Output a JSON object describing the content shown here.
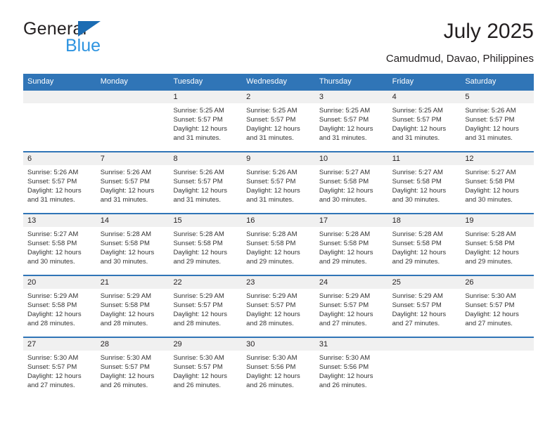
{
  "brand": {
    "name_top": "General",
    "name_bottom": "Blue",
    "logo_icon": "blue-triangle-icon",
    "accent_color": "#1b6cb3",
    "secondary_color": "#2e94e0"
  },
  "header": {
    "title": "July 2025",
    "subtitle": "Camudmud, Davao, Philippines"
  },
  "calendar": {
    "header_bg_color": "#3075b7",
    "day_band_color": "#f0f0f0",
    "weekdays": [
      "Sunday",
      "Monday",
      "Tuesday",
      "Wednesday",
      "Thursday",
      "Friday",
      "Saturday"
    ],
    "weeks": [
      [
        {
          "date": "",
          "sunrise": "",
          "sunset": "",
          "daylight_line1": "",
          "daylight_line2": ""
        },
        {
          "date": "",
          "sunrise": "",
          "sunset": "",
          "daylight_line1": "",
          "daylight_line2": ""
        },
        {
          "date": "1",
          "sunrise": "Sunrise: 5:25 AM",
          "sunset": "Sunset: 5:57 PM",
          "daylight_line1": "Daylight: 12 hours",
          "daylight_line2": "and 31 minutes."
        },
        {
          "date": "2",
          "sunrise": "Sunrise: 5:25 AM",
          "sunset": "Sunset: 5:57 PM",
          "daylight_line1": "Daylight: 12 hours",
          "daylight_line2": "and 31 minutes."
        },
        {
          "date": "3",
          "sunrise": "Sunrise: 5:25 AM",
          "sunset": "Sunset: 5:57 PM",
          "daylight_line1": "Daylight: 12 hours",
          "daylight_line2": "and 31 minutes."
        },
        {
          "date": "4",
          "sunrise": "Sunrise: 5:25 AM",
          "sunset": "Sunset: 5:57 PM",
          "daylight_line1": "Daylight: 12 hours",
          "daylight_line2": "and 31 minutes."
        },
        {
          "date": "5",
          "sunrise": "Sunrise: 5:26 AM",
          "sunset": "Sunset: 5:57 PM",
          "daylight_line1": "Daylight: 12 hours",
          "daylight_line2": "and 31 minutes."
        }
      ],
      [
        {
          "date": "6",
          "sunrise": "Sunrise: 5:26 AM",
          "sunset": "Sunset: 5:57 PM",
          "daylight_line1": "Daylight: 12 hours",
          "daylight_line2": "and 31 minutes."
        },
        {
          "date": "7",
          "sunrise": "Sunrise: 5:26 AM",
          "sunset": "Sunset: 5:57 PM",
          "daylight_line1": "Daylight: 12 hours",
          "daylight_line2": "and 31 minutes."
        },
        {
          "date": "8",
          "sunrise": "Sunrise: 5:26 AM",
          "sunset": "Sunset: 5:57 PM",
          "daylight_line1": "Daylight: 12 hours",
          "daylight_line2": "and 31 minutes."
        },
        {
          "date": "9",
          "sunrise": "Sunrise: 5:26 AM",
          "sunset": "Sunset: 5:57 PM",
          "daylight_line1": "Daylight: 12 hours",
          "daylight_line2": "and 31 minutes."
        },
        {
          "date": "10",
          "sunrise": "Sunrise: 5:27 AM",
          "sunset": "Sunset: 5:58 PM",
          "daylight_line1": "Daylight: 12 hours",
          "daylight_line2": "and 30 minutes."
        },
        {
          "date": "11",
          "sunrise": "Sunrise: 5:27 AM",
          "sunset": "Sunset: 5:58 PM",
          "daylight_line1": "Daylight: 12 hours",
          "daylight_line2": "and 30 minutes."
        },
        {
          "date": "12",
          "sunrise": "Sunrise: 5:27 AM",
          "sunset": "Sunset: 5:58 PM",
          "daylight_line1": "Daylight: 12 hours",
          "daylight_line2": "and 30 minutes."
        }
      ],
      [
        {
          "date": "13",
          "sunrise": "Sunrise: 5:27 AM",
          "sunset": "Sunset: 5:58 PM",
          "daylight_line1": "Daylight: 12 hours",
          "daylight_line2": "and 30 minutes."
        },
        {
          "date": "14",
          "sunrise": "Sunrise: 5:28 AM",
          "sunset": "Sunset: 5:58 PM",
          "daylight_line1": "Daylight: 12 hours",
          "daylight_line2": "and 30 minutes."
        },
        {
          "date": "15",
          "sunrise": "Sunrise: 5:28 AM",
          "sunset": "Sunset: 5:58 PM",
          "daylight_line1": "Daylight: 12 hours",
          "daylight_line2": "and 29 minutes."
        },
        {
          "date": "16",
          "sunrise": "Sunrise: 5:28 AM",
          "sunset": "Sunset: 5:58 PM",
          "daylight_line1": "Daylight: 12 hours",
          "daylight_line2": "and 29 minutes."
        },
        {
          "date": "17",
          "sunrise": "Sunrise: 5:28 AM",
          "sunset": "Sunset: 5:58 PM",
          "daylight_line1": "Daylight: 12 hours",
          "daylight_line2": "and 29 minutes."
        },
        {
          "date": "18",
          "sunrise": "Sunrise: 5:28 AM",
          "sunset": "Sunset: 5:58 PM",
          "daylight_line1": "Daylight: 12 hours",
          "daylight_line2": "and 29 minutes."
        },
        {
          "date": "19",
          "sunrise": "Sunrise: 5:28 AM",
          "sunset": "Sunset: 5:58 PM",
          "daylight_line1": "Daylight: 12 hours",
          "daylight_line2": "and 29 minutes."
        }
      ],
      [
        {
          "date": "20",
          "sunrise": "Sunrise: 5:29 AM",
          "sunset": "Sunset: 5:58 PM",
          "daylight_line1": "Daylight: 12 hours",
          "daylight_line2": "and 28 minutes."
        },
        {
          "date": "21",
          "sunrise": "Sunrise: 5:29 AM",
          "sunset": "Sunset: 5:58 PM",
          "daylight_line1": "Daylight: 12 hours",
          "daylight_line2": "and 28 minutes."
        },
        {
          "date": "22",
          "sunrise": "Sunrise: 5:29 AM",
          "sunset": "Sunset: 5:57 PM",
          "daylight_line1": "Daylight: 12 hours",
          "daylight_line2": "and 28 minutes."
        },
        {
          "date": "23",
          "sunrise": "Sunrise: 5:29 AM",
          "sunset": "Sunset: 5:57 PM",
          "daylight_line1": "Daylight: 12 hours",
          "daylight_line2": "and 28 minutes."
        },
        {
          "date": "24",
          "sunrise": "Sunrise: 5:29 AM",
          "sunset": "Sunset: 5:57 PM",
          "daylight_line1": "Daylight: 12 hours",
          "daylight_line2": "and 27 minutes."
        },
        {
          "date": "25",
          "sunrise": "Sunrise: 5:29 AM",
          "sunset": "Sunset: 5:57 PM",
          "daylight_line1": "Daylight: 12 hours",
          "daylight_line2": "and 27 minutes."
        },
        {
          "date": "26",
          "sunrise": "Sunrise: 5:30 AM",
          "sunset": "Sunset: 5:57 PM",
          "daylight_line1": "Daylight: 12 hours",
          "daylight_line2": "and 27 minutes."
        }
      ],
      [
        {
          "date": "27",
          "sunrise": "Sunrise: 5:30 AM",
          "sunset": "Sunset: 5:57 PM",
          "daylight_line1": "Daylight: 12 hours",
          "daylight_line2": "and 27 minutes."
        },
        {
          "date": "28",
          "sunrise": "Sunrise: 5:30 AM",
          "sunset": "Sunset: 5:57 PM",
          "daylight_line1": "Daylight: 12 hours",
          "daylight_line2": "and 26 minutes."
        },
        {
          "date": "29",
          "sunrise": "Sunrise: 5:30 AM",
          "sunset": "Sunset: 5:57 PM",
          "daylight_line1": "Daylight: 12 hours",
          "daylight_line2": "and 26 minutes."
        },
        {
          "date": "30",
          "sunrise": "Sunrise: 5:30 AM",
          "sunset": "Sunset: 5:56 PM",
          "daylight_line1": "Daylight: 12 hours",
          "daylight_line2": "and 26 minutes."
        },
        {
          "date": "31",
          "sunrise": "Sunrise: 5:30 AM",
          "sunset": "Sunset: 5:56 PM",
          "daylight_line1": "Daylight: 12 hours",
          "daylight_line2": "and 26 minutes."
        },
        {
          "date": "",
          "sunrise": "",
          "sunset": "",
          "daylight_line1": "",
          "daylight_line2": ""
        },
        {
          "date": "",
          "sunrise": "",
          "sunset": "",
          "daylight_line1": "",
          "daylight_line2": ""
        }
      ]
    ]
  }
}
